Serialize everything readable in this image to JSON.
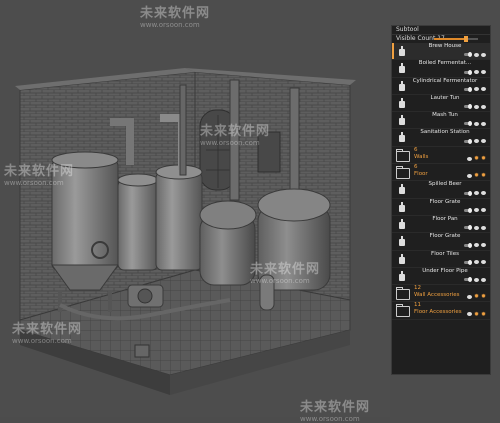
{
  "subtool_panel": {
    "title": "Subtool",
    "visible_count_label": "Visible Count 17",
    "visible_slider_level": 0.72,
    "accent_color": "#f0a040",
    "items": [
      {
        "label": "Brew House",
        "type": "mesh",
        "selected": true
      },
      {
        "label": "Boiled Fermentat...",
        "type": "mesh"
      },
      {
        "label": "Cylindrical Fermentator",
        "type": "mesh"
      },
      {
        "label": "Lauter Tun",
        "type": "mesh"
      },
      {
        "label": "Mash Tun",
        "type": "mesh"
      },
      {
        "label": "Sanitation Station",
        "type": "mesh"
      },
      {
        "label": "Walls",
        "count": "6",
        "type": "folder"
      },
      {
        "label": "Floor",
        "count": "6",
        "type": "folder"
      },
      {
        "label": "Spilled Beer",
        "type": "mesh"
      },
      {
        "label": "Floor Grate",
        "type": "mesh"
      },
      {
        "label": "Floor Pan",
        "type": "mesh"
      },
      {
        "label": "Floor Grate",
        "type": "mesh"
      },
      {
        "label": "Floor Tiles",
        "type": "mesh"
      },
      {
        "label": "Under Floor Pipe",
        "type": "mesh"
      },
      {
        "label": "Wall Accessories",
        "count": "12",
        "type": "folder"
      },
      {
        "label": "Floor Accessories",
        "count": "11",
        "type": "folder"
      }
    ]
  },
  "watermarks": {
    "brand": "未来软件网",
    "url": "www.orsoon.com"
  }
}
